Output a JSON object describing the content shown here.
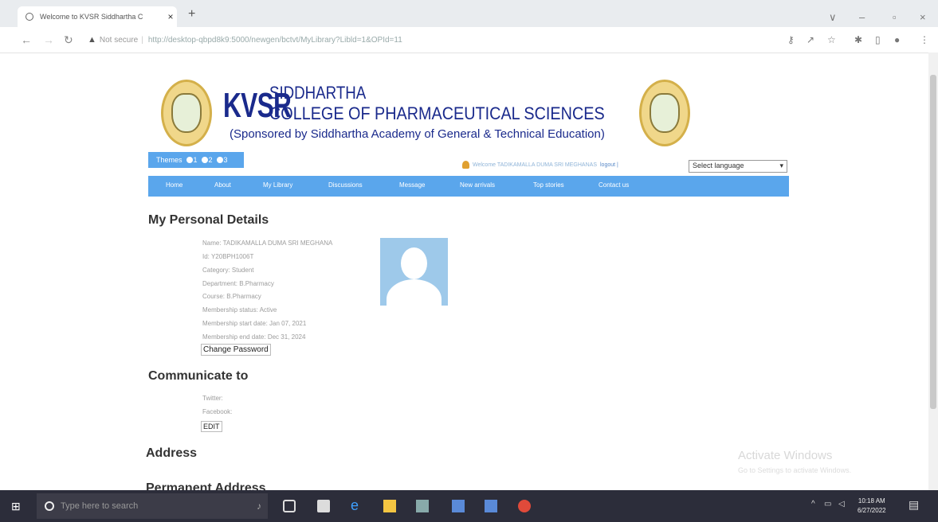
{
  "browser": {
    "tab_title": "Welcome to KVSR Siddhartha C",
    "tab_close": "×",
    "new_tab": "+",
    "not_secure": "Not secure",
    "url": "http://desktop-qbpd8k9:5000/newgen/bctvt/MyLibrary?Libld=1&OPId=11",
    "window_controls": [
      "∨",
      "–",
      "▫",
      "×"
    ]
  },
  "header": {
    "kvsr": "KVSR",
    "line1": "SIDDHARTHA",
    "line2": "COLLEGE OF PHARMACEUTICAL SCIENCES",
    "line3": "(Sponsored by Siddhartha Academy of General & Technical Education)",
    "themes_label": "Themes",
    "themes": [
      "1",
      "2",
      "3"
    ],
    "welcome": "Welcome  TADIKAMALLA DUMA SRI MEGHANAS",
    "logout": "logout |",
    "language": "Select language"
  },
  "menu": [
    "Home",
    "About",
    "My Library",
    "Discussions",
    "Message",
    "New arrivals",
    "Top stories",
    "Contact us"
  ],
  "personal": {
    "title": "My Personal Details",
    "name": "Name: TADIKAMALLA DUMA SRI MEGHANA",
    "id": "Id: Y20BPH1006T",
    "category": "Category: Student",
    "department": "Department: B.Pharmacy",
    "course": "Course: B.Pharmacy",
    "membership_status": "Membership status: Active",
    "membership_start": "Membership start date: Jan 07, 2021",
    "membership_end": "Membership end date: Dec 31, 2024",
    "change_password": "Change Password"
  },
  "communicate": {
    "title": "Communicate to",
    "twitter": "Twitter:",
    "facebook": "Facebook:",
    "edit": "EDIT"
  },
  "address": {
    "title": "Address",
    "permanent": "Permanent Address"
  },
  "watermark": {
    "title": "Activate Windows",
    "subtitle": "Go to Settings to activate Windows."
  },
  "taskbar": {
    "search_placeholder": "Type here to search",
    "time": "10:18 AM",
    "date": "6/27/2022"
  }
}
